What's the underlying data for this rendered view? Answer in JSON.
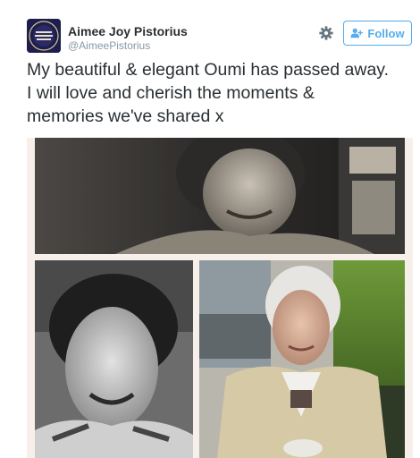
{
  "user": {
    "display_name": "Aimee Joy Pistorius",
    "handle": "@AimeePistorius",
    "avatar_icon": "profile-avatar"
  },
  "actions": {
    "settings_icon": "gear-icon",
    "follow_icon": "add-user-icon",
    "follow_label": "Follow"
  },
  "tweet": {
    "text_lines": [
      "My beautiful & elegant Oumi has passed away.",
      "I will love and cherish the moments &",
      "memories we've shared x"
    ]
  },
  "media": {
    "photos": [
      "sepia-portrait-smiling-woman",
      "black-white-portrait-woman",
      "color-portrait-elderly-woman"
    ]
  },
  "colors": {
    "accent": "#55acee",
    "text": "#292f33",
    "muted": "#8899a6",
    "frame": "#f7f0ea"
  }
}
